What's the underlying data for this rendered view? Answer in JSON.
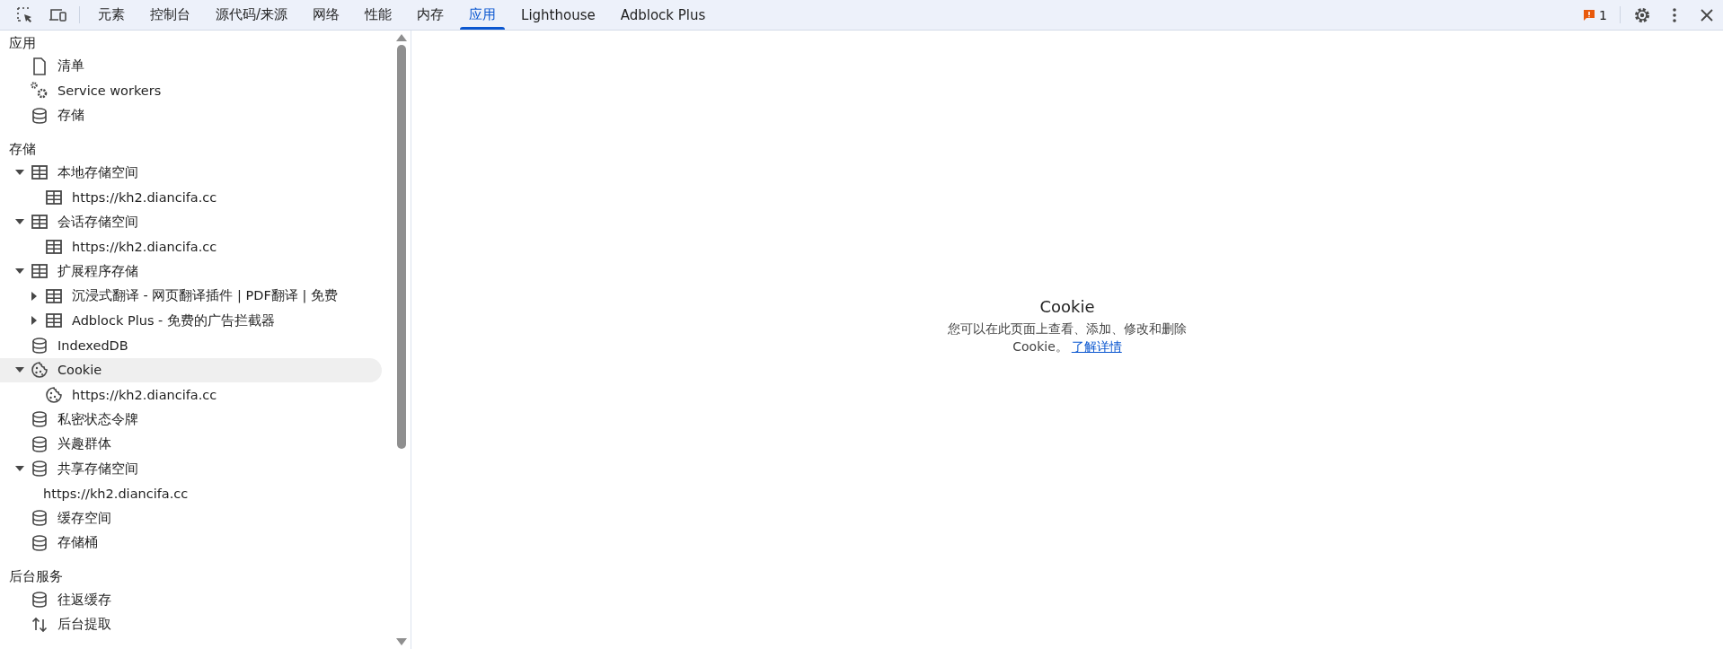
{
  "toolbar": {
    "tabs": [
      {
        "label": "元素",
        "selected": false
      },
      {
        "label": "控制台",
        "selected": false
      },
      {
        "label": "源代码/来源",
        "selected": false
      },
      {
        "label": "网络",
        "selected": false
      },
      {
        "label": "性能",
        "selected": false
      },
      {
        "label": "内存",
        "selected": false
      },
      {
        "label": "应用",
        "selected": true
      },
      {
        "label": "Lighthouse",
        "selected": false
      },
      {
        "label": "Adblock Plus",
        "selected": false
      }
    ],
    "issues_count": "1"
  },
  "sidebar": {
    "sections": [
      {
        "title": "应用",
        "items": [
          {
            "label": "清单",
            "kind": "file",
            "selected": false
          },
          {
            "label": "Service workers",
            "kind": "gears",
            "selected": false
          },
          {
            "label": "存储",
            "kind": "database",
            "selected": false
          }
        ]
      },
      {
        "title": "存储",
        "items": [
          {
            "label": "本地存储空间",
            "kind": "table",
            "selected": false,
            "expanded": true,
            "children": [
              {
                "label": "https://kh2.diancifa.cc",
                "kind": "table",
                "selected": false
              }
            ]
          },
          {
            "label": "会话存储空间",
            "kind": "table",
            "selected": false,
            "expanded": true,
            "children": [
              {
                "label": "https://kh2.diancifa.cc",
                "kind": "table",
                "selected": false
              }
            ]
          },
          {
            "label": "扩展程序存储",
            "kind": "table",
            "selected": false,
            "expanded": true,
            "children": [
              {
                "label": "沉浸式翻译 - 网页翻译插件 | PDF翻译 | 免费",
                "kind": "table",
                "selected": false,
                "expanded": false
              },
              {
                "label": "Adblock Plus - 免费的广告拦截器",
                "kind": "table",
                "selected": false,
                "expanded": false
              }
            ]
          },
          {
            "label": "IndexedDB",
            "kind": "database",
            "selected": false
          },
          {
            "label": "Cookie",
            "kind": "cookie",
            "selected": true,
            "expanded": true,
            "children": [
              {
                "label": "https://kh2.diancifa.cc",
                "kind": "cookie",
                "selected": false
              }
            ]
          },
          {
            "label": "私密状态令牌",
            "kind": "database",
            "selected": false
          },
          {
            "label": "兴趣群体",
            "kind": "database",
            "selected": false
          },
          {
            "label": "共享存储空间",
            "kind": "database",
            "selected": false,
            "expanded": true,
            "children": [
              {
                "label": "https://kh2.diancifa.cc",
                "kind": "plain",
                "selected": false
              }
            ]
          },
          {
            "label": "缓存空间",
            "kind": "database",
            "selected": false
          },
          {
            "label": "存储桶",
            "kind": "database",
            "selected": false
          }
        ]
      },
      {
        "title": "后台服务",
        "items": [
          {
            "label": "往返缓存",
            "kind": "database",
            "selected": false
          },
          {
            "label": "后台提取",
            "kind": "arrows",
            "selected": false
          }
        ]
      }
    ]
  },
  "main": {
    "title": "Cookie",
    "description": "您可以在此页面上查看、添加、修改和删除 Cookie。",
    "link": "了解详情"
  }
}
